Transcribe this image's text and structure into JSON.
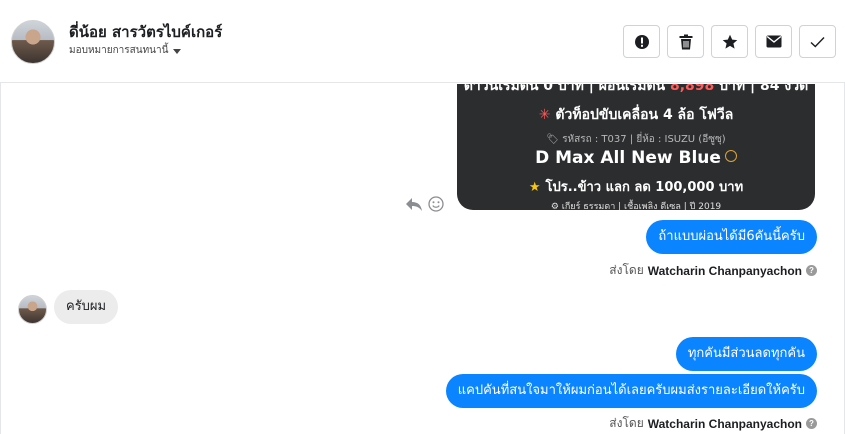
{
  "header": {
    "contact_name": "ดี่น้อย สารวัตรไบค์เกอร์",
    "assign_label": "มอบหมายการสนทนานี้",
    "actions": [
      "report",
      "delete",
      "star",
      "mark-unread",
      "done"
    ]
  },
  "card": {
    "line1_pre": "ดาวน์เริ่มต้น 0 บาท | ผ่อนเริ่มต้น ",
    "line1_price": "8,898",
    "line1_post": " บาท | 84 งวด",
    "line2": "ตัวท็อปขับเคลื่อน 4 ล้อ โฟวีล",
    "line3": "รหัสรถ : T037 | ยี่ห้อ : ISUZU (อีซูซุ)",
    "model": "D Max All New Blue",
    "promo": "โปร..ข้าว แลก ลด 100,000 บาท",
    "specs": "เกียร์ ธรรมดา  |  เชื้อเพลิง ดีเซล  |  ปี 2019",
    "accent_red": "#ff5a5a",
    "star_color": "#f5c518"
  },
  "messages": {
    "out1": "ถ้าแบบผ่อนได้มี6คันนี้ครับ",
    "in1": "ครับผม",
    "out2": "ทุกคันมีส่วนลดทุกคัน",
    "out3": "แคปคันที่สนใจมาให้ผมก่อนได้เลยครับผมส่งรายละเอียดให้ครับ"
  },
  "sent_by": {
    "label": "ส่งโดย",
    "name": "Watcharin Chanpanyachon",
    "help": "?"
  },
  "colors": {
    "bubble_blue": "#0a84ff",
    "bubble_gray": "#ececec"
  }
}
